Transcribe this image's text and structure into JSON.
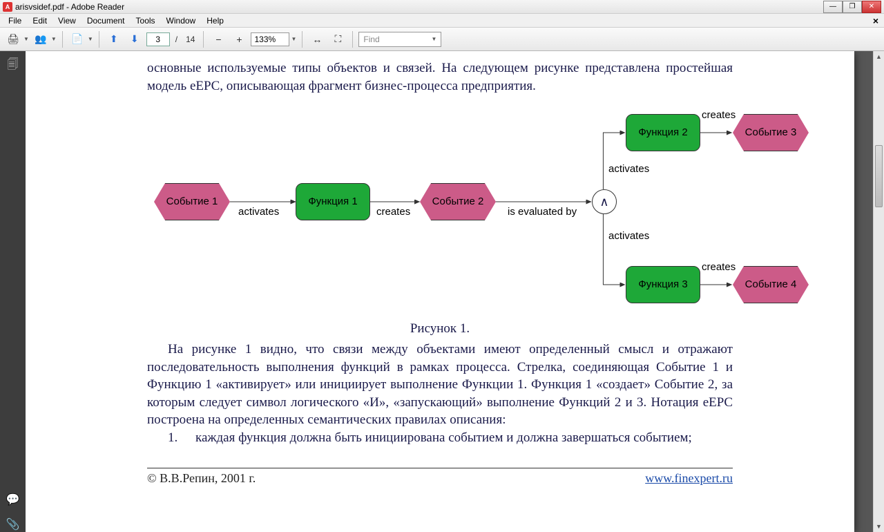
{
  "window": {
    "title": "arisvsidef.pdf - Adobe Reader"
  },
  "menu": {
    "file": "File",
    "edit": "Edit",
    "view": "View",
    "document": "Document",
    "tools": "Tools",
    "window": "Window",
    "help": "Help"
  },
  "toolbar": {
    "page_current": "3",
    "page_sep": "/",
    "page_total": "14",
    "zoom": "133%",
    "find_placeholder": "Find"
  },
  "document": {
    "intro": "основные используемые типы объектов и связей. На следующем рисунке представлена простейшая модель eEPC, описывающая фрагмент бизнес-процесса предприятия.",
    "fig_caption": "Рисунок 1.",
    "para1": "На рисунке 1 видно, что связи между объектами имеют определенный смысл и отражают последовательность выполнения функций в рамках процесса.  Стрелка, соединяющая Событие 1 и Функцию 1 «активирует» или инициирует выполнение Функции 1. Функция 1 «создает» Событие 2, за которым следует символ логического «И», «запускающий» выполнение Функций 2 и 3. Нотация eEPC построена на определенных семантических правилах описания:",
    "list1_num": "1.",
    "list1_txt": "каждая функция должна быть инициирована событием и должна завершаться событием;",
    "footer_left": "© В.В.Репин, 2001 г.",
    "footer_right": "www.finexpert.ru"
  },
  "diagram": {
    "event1": "Событие 1",
    "event2": "Событие 2",
    "event3": "Событие 3",
    "event4": "Событие 4",
    "func1": "Функция 1",
    "func2": "Функция 2",
    "func3": "Функция 3",
    "gate": "∧",
    "activates": "activates",
    "creates": "creates",
    "is_evaluated_by": "is evaluated by"
  }
}
